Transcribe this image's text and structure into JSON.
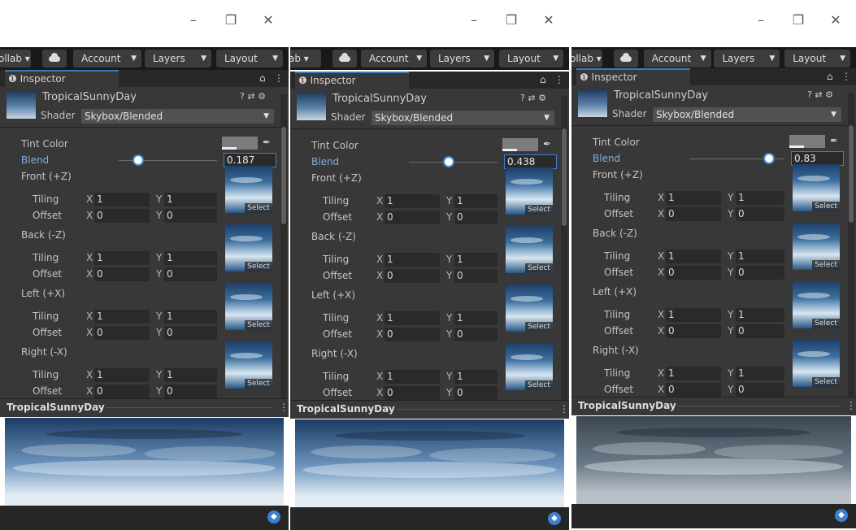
{
  "window": {
    "minimize_icon": "–",
    "restore_icon": "❐",
    "close_icon": "✕"
  },
  "toolbar": {
    "collab_labels": [
      "ollab ▾",
      "ab ▾",
      "ollab ▾"
    ],
    "account": "Account",
    "layers": "Layers",
    "layout": "Layout"
  },
  "inspector": {
    "tab_label": "Inspector",
    "asset_name": "TropicalSunnyDay",
    "shader_label": "Shader",
    "shader_value": "Skybox/Blended",
    "tint_label": "Tint Color",
    "blend_label": "Blend",
    "tiling_label": "Tiling",
    "offset_label": "Offset",
    "x_axis": "X",
    "y_axis": "Y",
    "tiling_value": "1",
    "offset_value": "0",
    "select_label": "Select",
    "faces": [
      "Front (+Z)",
      "Back (-Z)",
      "Left (+X)",
      "Right (-X)"
    ]
  },
  "panels": [
    {
      "blend_value": "0.187",
      "blend_fraction": 0.187
    },
    {
      "blend_value": "0.438",
      "blend_fraction": 0.438
    },
    {
      "blend_value": "0.83",
      "blend_fraction": 0.83
    }
  ],
  "preview": {
    "title": "TropicalSunnyDay"
  },
  "colors": {
    "accent": "#3c7fd1",
    "panel_bg": "#383838",
    "toolbar_bg": "#191919"
  }
}
